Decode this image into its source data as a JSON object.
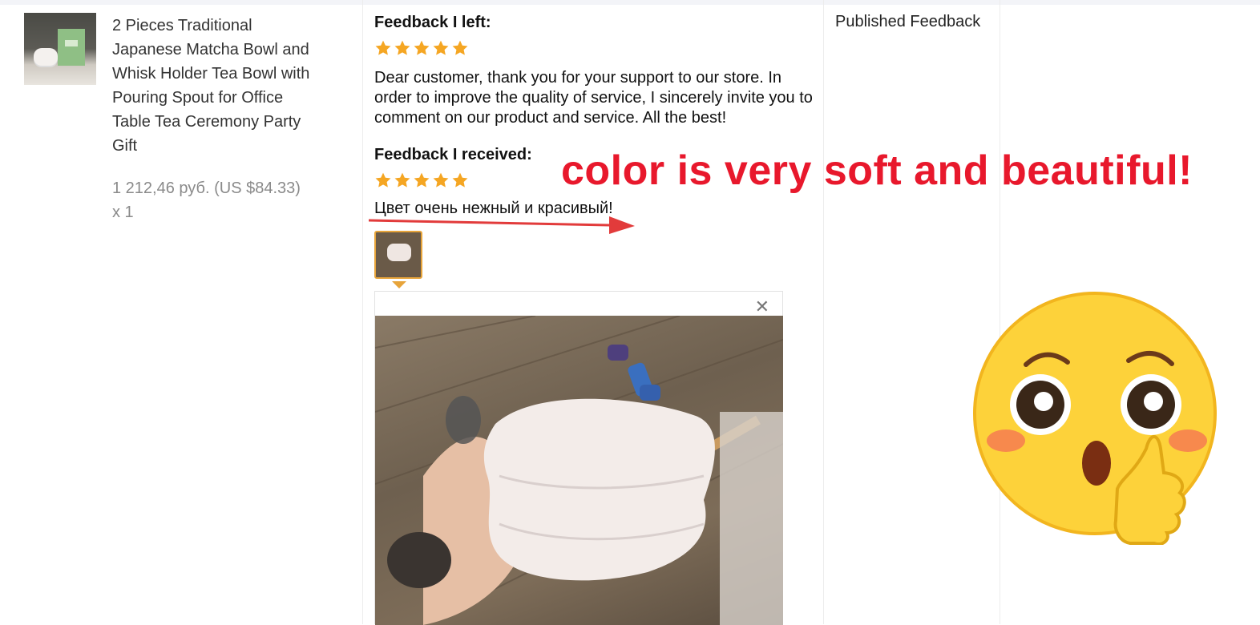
{
  "product": {
    "title": "2 Pieces Traditional Japanese Matcha Bowl and Whisk Holder Tea Bowl with Pouring Spout for Office Table Tea Ceremony Party Gift",
    "price": "1 212,46 руб. (US $84.33)",
    "quantity": "x 1"
  },
  "feedback": {
    "left_label": "Feedback I left:",
    "left_rating": 5,
    "left_text": "Dear customer, thank you for your support to our store. In order to improve the quality of service, I sincerely invite you to comment on our product and service. All the best!",
    "received_label": "Feedback I received:",
    "received_rating": 5,
    "received_text": "Цвет очень нежный и красивый!"
  },
  "annotation": {
    "text": "color is very soft and beautiful!",
    "color": "#e8182c"
  },
  "status": {
    "label": "Published Feedback"
  },
  "preview": {
    "close_icon": "close-icon"
  },
  "colors": {
    "star": "#f5a623",
    "thumb_border": "#e7a43a",
    "emoji_face": "#fdd23a"
  }
}
